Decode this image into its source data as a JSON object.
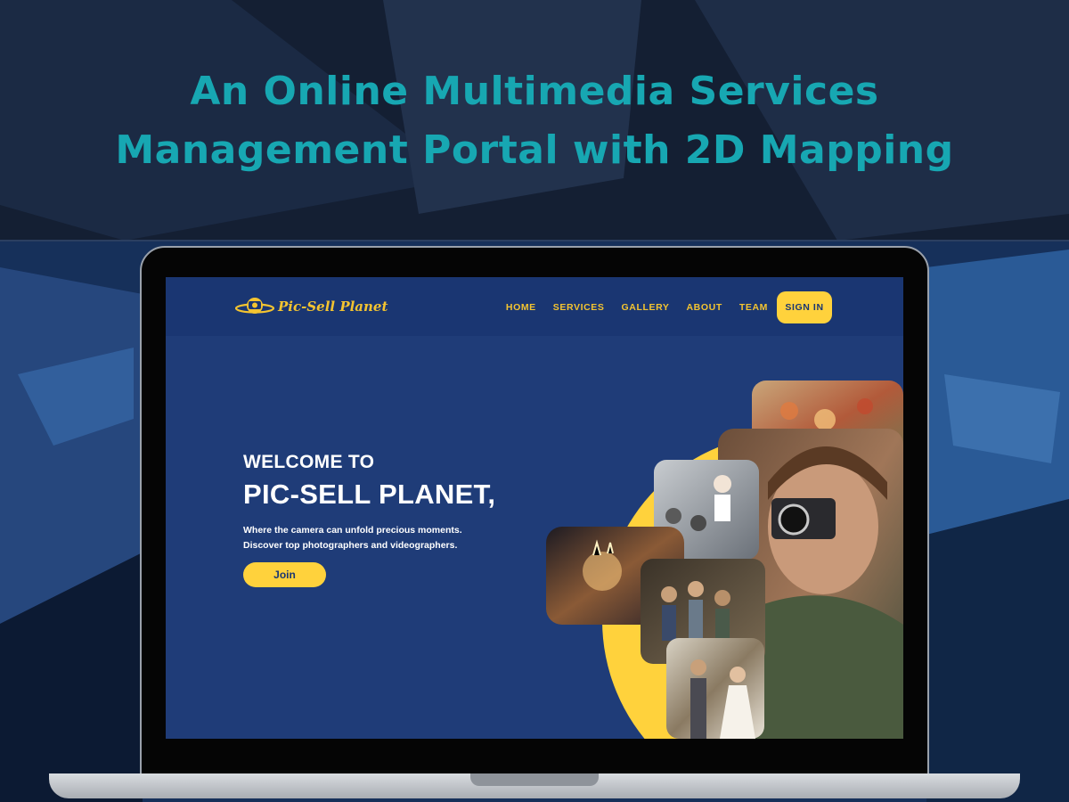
{
  "banner": {
    "line1": "An Online Multimedia Services",
    "line2": "Management Portal with 2D Mapping"
  },
  "site": {
    "logo_text": "Pic-Sell Planet",
    "nav": [
      "HOME",
      "SERVICES",
      "GALLERY",
      "ABOUT",
      "TEAM"
    ],
    "signin_label": "SIGN IN",
    "hero": {
      "pre_title": "WELCOME TO",
      "title": "PIC-SELL PLANET,",
      "subtitle_line1": "Where the camera can unfold precious moments.",
      "subtitle_line2": "Discover top photographers and videographers.",
      "cta_label": "Join"
    }
  },
  "colors": {
    "headline": "#17a7b2",
    "accent": "#ffd23c",
    "navbar": "#1a3672",
    "hero_bg": "#1f3c78"
  }
}
